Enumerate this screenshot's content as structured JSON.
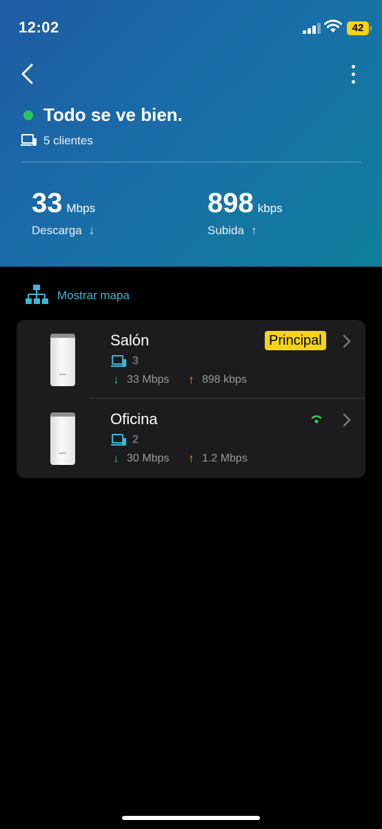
{
  "status_bar": {
    "time": "12:02",
    "battery": "42",
    "icons": [
      "cellular-signal-icon",
      "wifi-icon",
      "battery-icon"
    ]
  },
  "header": {
    "back_icon": "chevron-left-icon",
    "more_icon": "more-vertical-icon",
    "status_title": "Todo se ve bien.",
    "status_color": "#27c75a",
    "clients": "5 clientes",
    "download": {
      "value": "33",
      "unit": "Mbps",
      "label": "Descarga",
      "arrow": "↓"
    },
    "upload": {
      "value": "898",
      "unit": "kbps",
      "label": "Subida",
      "arrow": "↑"
    }
  },
  "map_link": {
    "label": "Mostrar mapa",
    "icon": "network-topology-icon",
    "color": "#3ab8d6"
  },
  "devices": [
    {
      "name": "Salón",
      "badge": "Principal",
      "clients": "3",
      "down_arrow": "↓",
      "download": "33 Mbps",
      "up_arrow": "↑",
      "upload": "898 kbps"
    },
    {
      "name": "Oficina",
      "clients": "2",
      "down_arrow": "↓",
      "download": "30 Mbps",
      "up_arrow": "↑",
      "upload": "1.2 Mbps",
      "signal_icon": "wifi-signal-icon"
    }
  ],
  "colors": {
    "header_gradient_start": "#1e5ba3",
    "header_gradient_end": "#0f7f9c",
    "accent": "#3ab8d6",
    "badge": "#f7d316",
    "download": "#30d158",
    "upload": "#ff9f0a"
  }
}
